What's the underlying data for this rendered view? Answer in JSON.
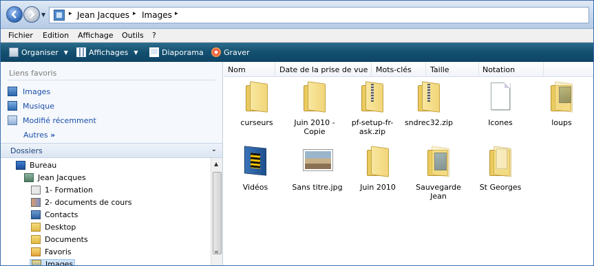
{
  "address": {
    "crumbs": [
      "Jean Jacques",
      "Images"
    ],
    "separator": "▸"
  },
  "menu": [
    "Fichier",
    "Edition",
    "Affichage",
    "Outils",
    "?"
  ],
  "commands": [
    {
      "label": "Organiser",
      "icon": "organize-icon",
      "dropdown": true
    },
    {
      "label": "Affichages",
      "icon": "views-icon",
      "dropdown": true
    },
    {
      "label": "Diaporama",
      "icon": "slideshow-icon",
      "dropdown": false
    },
    {
      "label": "Graver",
      "icon": "burn-disc-icon",
      "dropdown": false
    }
  ],
  "favorites": {
    "title": "Liens favoris",
    "links": [
      {
        "label": "Images",
        "icon": "pictures-icon"
      },
      {
        "label": "Musique",
        "icon": "music-icon"
      },
      {
        "label": "Modifié récemment",
        "icon": "recent-icon"
      }
    ],
    "more": "Autres",
    "more_glyph": "»"
  },
  "folders": {
    "title": "Dossiers",
    "tree": [
      {
        "label": "Bureau",
        "icon": "desktop-icon",
        "level": 0
      },
      {
        "label": "Jean Jacques",
        "icon": "user-folder-icon",
        "level": 1
      },
      {
        "label": "1- Formation",
        "icon": "special-folder-icon",
        "level": 2
      },
      {
        "label": "2- documents de cours",
        "icon": "people-folder-icon",
        "level": 2
      },
      {
        "label": "Contacts",
        "icon": "contacts-icon",
        "level": 2
      },
      {
        "label": "Desktop",
        "icon": "folder-icon",
        "level": 2
      },
      {
        "label": "Documents",
        "icon": "folder-icon",
        "level": 2
      },
      {
        "label": "Favoris",
        "icon": "favorites-icon",
        "level": 2
      },
      {
        "label": "Images",
        "icon": "pictures-folder-icon",
        "level": 2,
        "selected": true
      }
    ]
  },
  "columns": [
    "Nom",
    "Date de la prise de vue",
    "Mots-clés",
    "Taille",
    "Notation"
  ],
  "items": [
    {
      "label": "curseurs",
      "icon": "folder-icon"
    },
    {
      "label": "Juin 2010 - Copie",
      "icon": "folder-icon"
    },
    {
      "label": "pf-setup-fr-ask.zip",
      "icon": "zip-folder-icon"
    },
    {
      "label": "sndrec32.zip",
      "icon": "zip-folder-icon"
    },
    {
      "label": "Icones",
      "icon": "document-icon"
    },
    {
      "label": "loups",
      "icon": "photo-folder-icon"
    },
    {
      "label": "Vidéos",
      "icon": "video-folder-icon"
    },
    {
      "label": "Sans titre.jpg",
      "icon": "image-file-icon"
    },
    {
      "label": "Juin 2010",
      "icon": "folder-icon"
    },
    {
      "label": "Sauvegarde Jean",
      "icon": "image-folder-icon"
    },
    {
      "label": "St Georges",
      "icon": "folder-icon"
    }
  ]
}
